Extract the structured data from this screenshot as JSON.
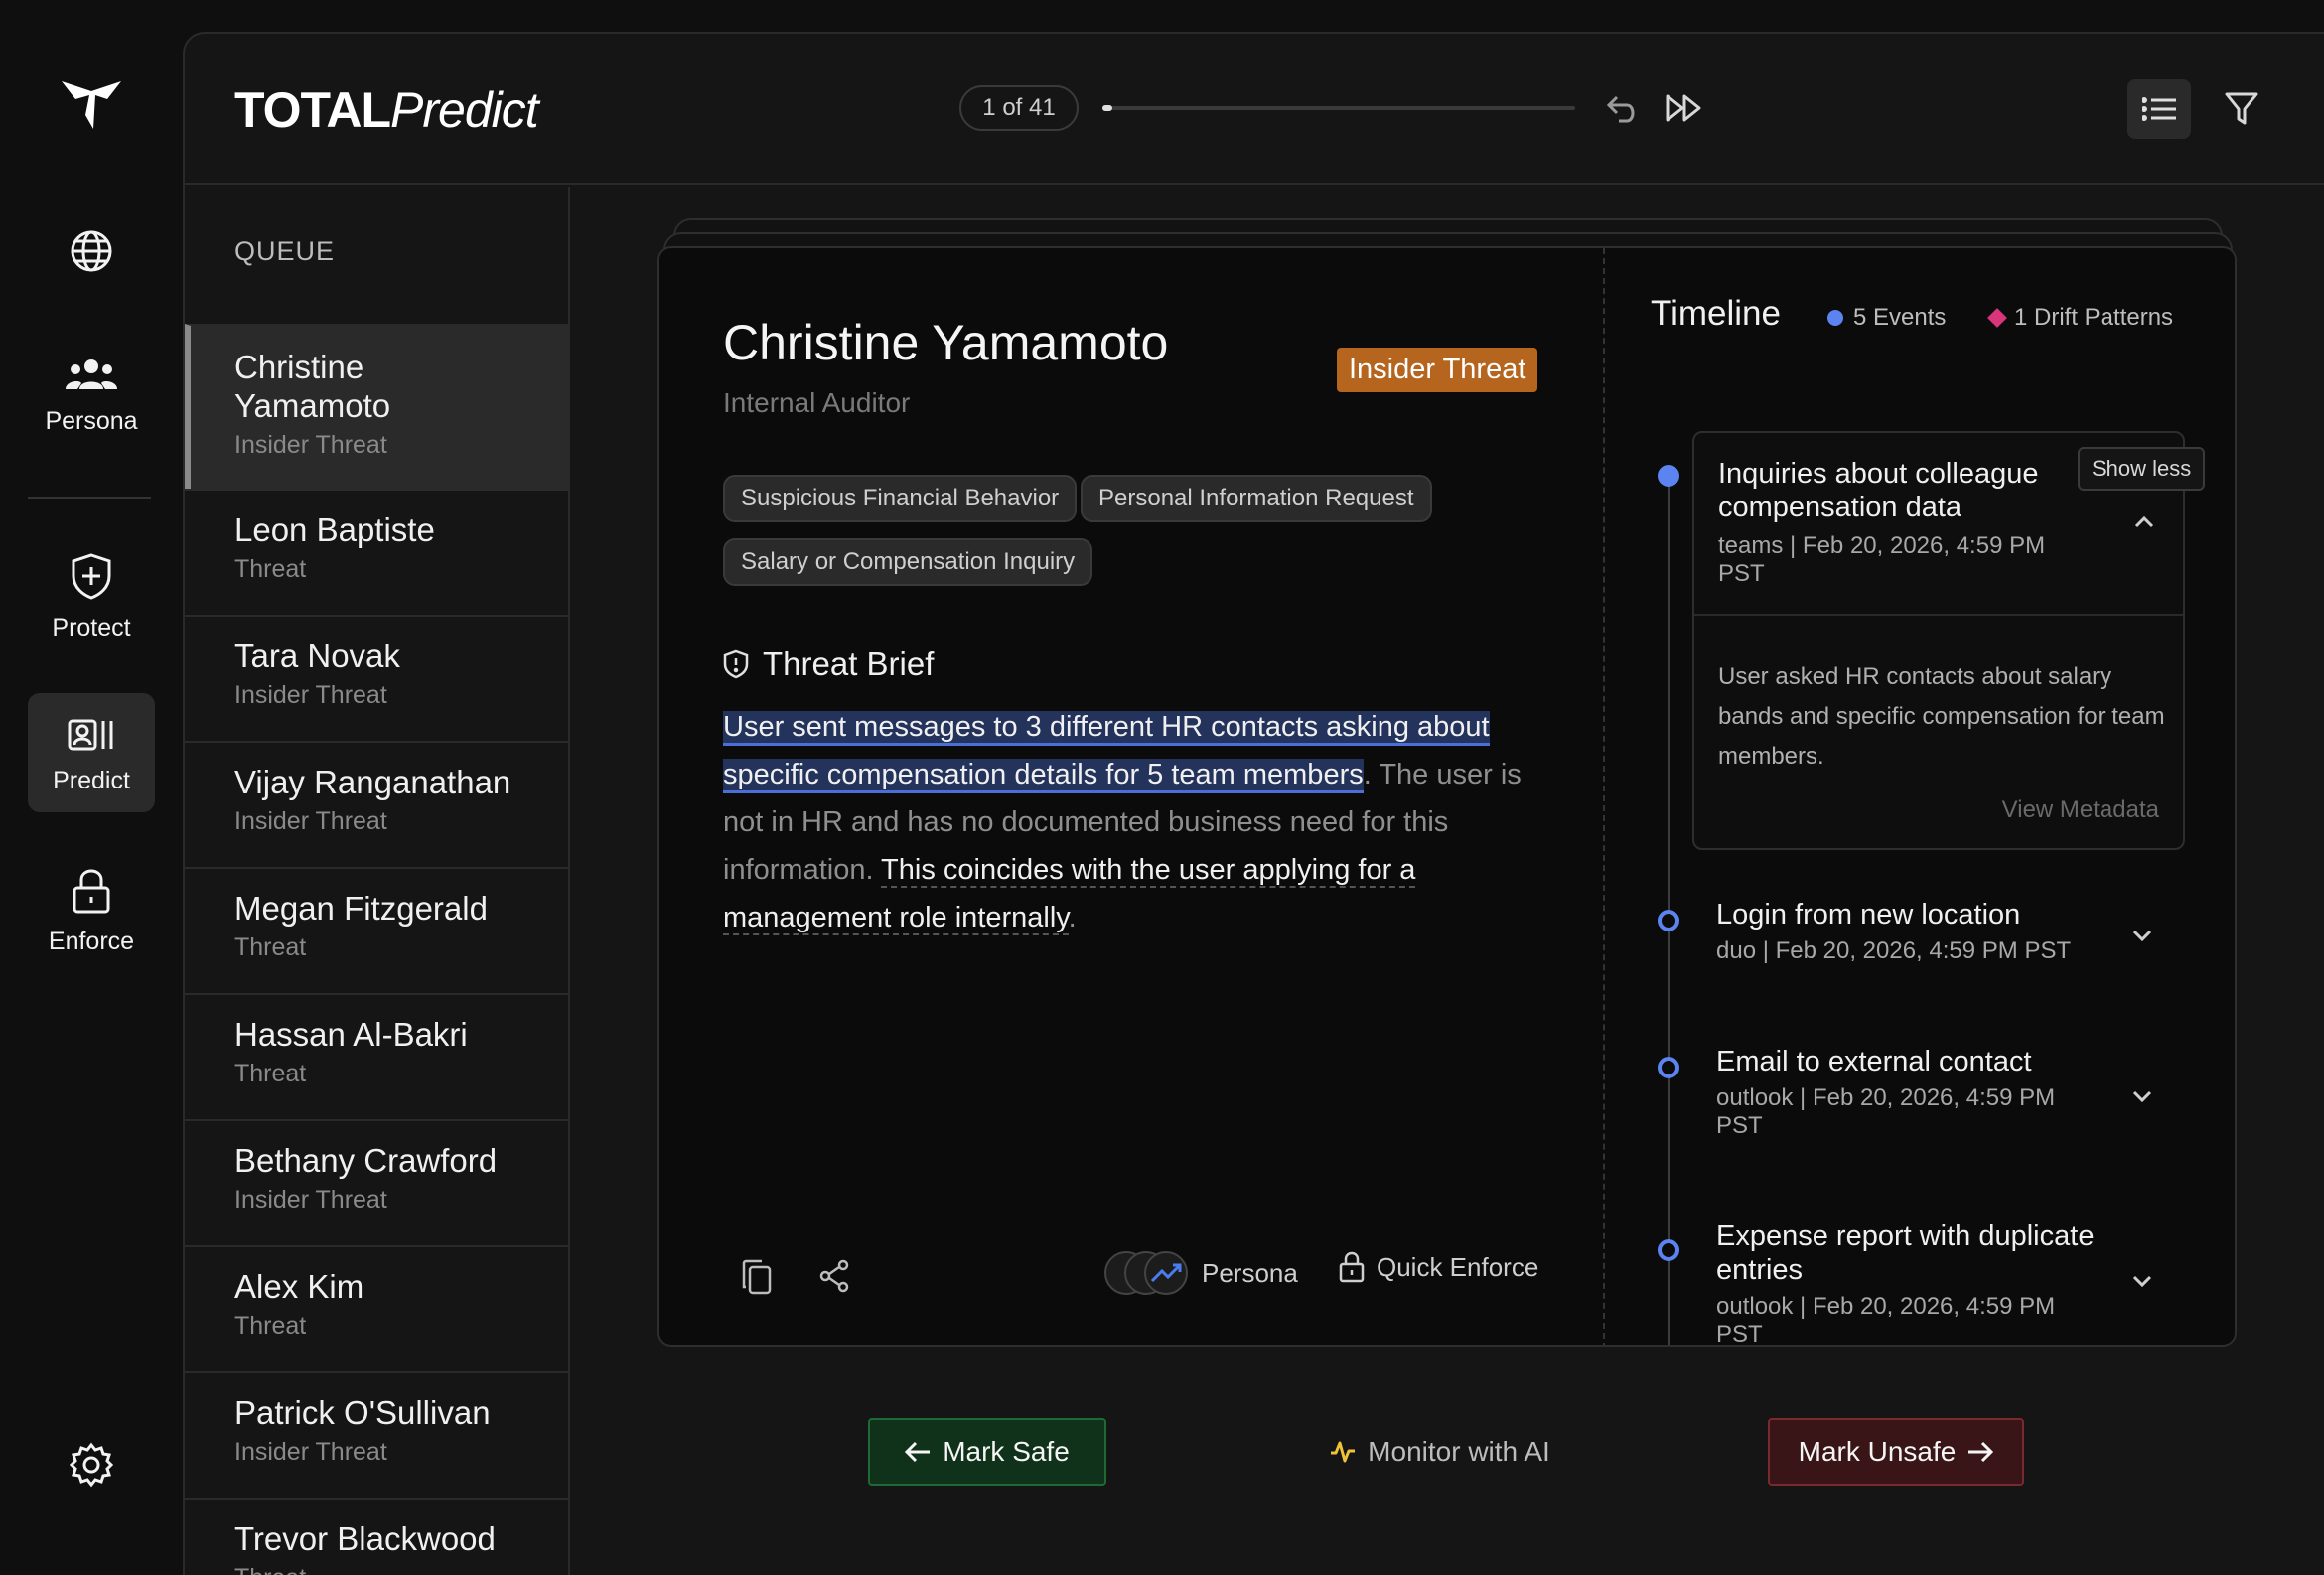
{
  "app": {
    "brand_bold": "TOTAL",
    "brand_italic": "Predict"
  },
  "nav": {
    "items": [
      {
        "label": "",
        "icon": "globe-icon"
      },
      {
        "label": "Persona",
        "icon": "people-icon"
      },
      {
        "label": "Protect",
        "icon": "shield-plus-icon"
      },
      {
        "label": "Predict",
        "icon": "predict-icon",
        "active": true
      },
      {
        "label": "Enforce",
        "icon": "lock-icon"
      },
      {
        "label": "",
        "icon": "gear-icon"
      }
    ]
  },
  "topbar": {
    "counter": "1 of 41",
    "progress": 0.02
  },
  "queue": {
    "title": "QUEUE",
    "items": [
      {
        "name": "Christine Yamamoto",
        "type": "Insider Threat",
        "active": true
      },
      {
        "name": "Leon Baptiste",
        "type": "Threat"
      },
      {
        "name": "Tara Novak",
        "type": "Insider Threat"
      },
      {
        "name": "Vijay Ranganathan",
        "type": "Insider Threat"
      },
      {
        "name": "Megan Fitzgerald",
        "type": "Threat"
      },
      {
        "name": "Hassan Al-Bakri",
        "type": "Threat"
      },
      {
        "name": "Bethany Crawford",
        "type": "Insider Threat"
      },
      {
        "name": "Alex Kim",
        "type": "Threat"
      },
      {
        "name": "Patrick O'Sullivan",
        "type": "Insider Threat"
      },
      {
        "name": "Trevor Blackwood",
        "type": "Threat"
      }
    ]
  },
  "case": {
    "name": "Christine Yamamoto",
    "role": "Internal Auditor",
    "badge": "Insider Threat",
    "badge_color": "#b5651d",
    "tags": [
      "Suspicious Financial Behavior",
      "Personal Information Request",
      "Salary or Compensation Inquiry"
    ],
    "brief_title": "Threat Brief",
    "brief_highlight": "User sent messages to 3 different HR contacts asking about specific compensation details for 5 team members",
    "brief_plain": ". The user is not in HR and has no documented business need for this information. ",
    "brief_underlined": "This coincides with the user applying for a management role internally",
    "brief_end": ".",
    "persona_link": "Persona",
    "quick_enforce": "Quick Enforce"
  },
  "timeline": {
    "title": "Timeline",
    "events_count": "5 Events",
    "drift_count": "1 Drift Patterns",
    "show_less": "Show less",
    "events": [
      {
        "title": "Inquiries about colleague compensation data",
        "meta": "teams | Feb 20, 2026, 4:59 PM PST",
        "desc": "User asked HR contacts about salary bands and specific compensation for team members.",
        "link": "View Metadata"
      },
      {
        "title": "Login from new location",
        "meta": "duo | Feb 20, 2026, 4:59 PM PST"
      },
      {
        "title": "Email to external contact",
        "meta": "outlook | Feb 20, 2026, 4:59 PM PST"
      },
      {
        "title": "Expense report with duplicate entries",
        "meta": "outlook | Feb 20, 2026, 4:59 PM PST"
      }
    ]
  },
  "actions": {
    "safe": "Mark Safe",
    "monitor": "Monitor with AI",
    "unsafe": "Mark Unsafe"
  }
}
